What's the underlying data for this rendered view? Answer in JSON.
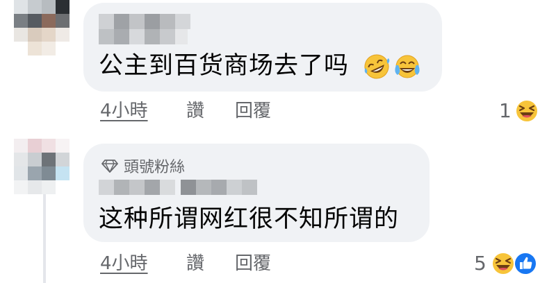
{
  "comments": [
    {
      "badge": "",
      "text": "公主到百货商场去了吗",
      "text_emojis": [
        "rolling-on-floor-laughing",
        "tears-of-joy"
      ],
      "time": "4小時",
      "like_label": "讚",
      "reply_label": "回覆",
      "reaction_count": "1",
      "reactions": [
        "laughing"
      ]
    },
    {
      "badge": "頭號粉絲",
      "text": "这种所谓网红很不知所谓的",
      "time": "4小時",
      "like_label": "讚",
      "reply_label": "回覆",
      "reaction_count": "5",
      "reactions": [
        "laughing",
        "like"
      ]
    }
  ],
  "colors": {
    "bubble": "#f0f2f5",
    "secondary_text": "#65676b",
    "like_blue": "#1877f2",
    "emoji_yellow": "#f7c43a"
  }
}
